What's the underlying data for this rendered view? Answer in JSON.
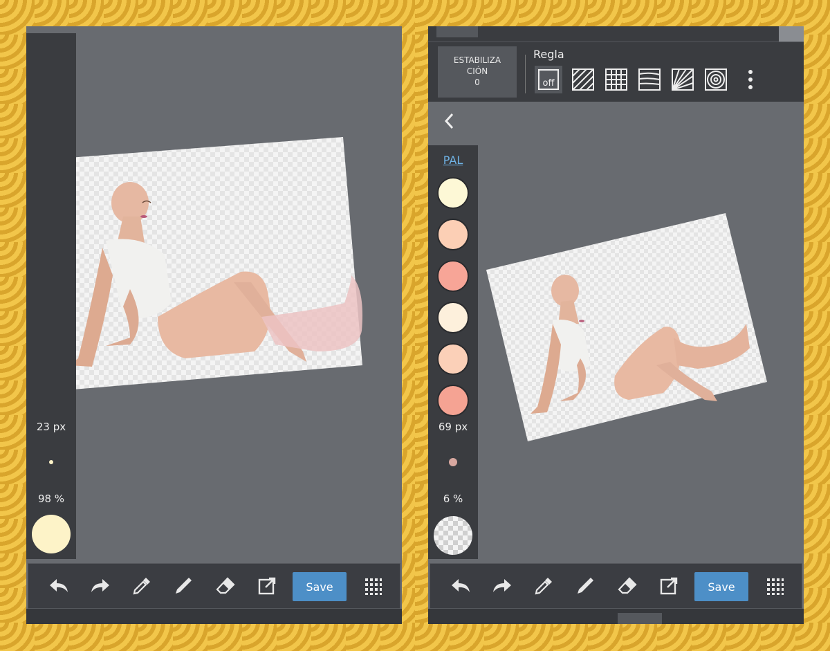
{
  "left": {
    "brush_size": "23 px",
    "opacity": "98 %",
    "color": "#fdf3c8",
    "save_label": "Save"
  },
  "right": {
    "stabilization_label": "ESTABILIZA CIÓN",
    "stabilization_value": "0",
    "ruler_title": "Regla",
    "ruler_off_label": "off",
    "palette_label": "PAL",
    "palette_colors": [
      "#fdf8d6",
      "#fccfb5",
      "#f7a597",
      "#fdf0dc",
      "#fbd0b8",
      "#f5a393"
    ],
    "brush_size": "69 px",
    "opacity": "6 %",
    "save_label": "Save"
  },
  "icons": [
    "undo-icon",
    "redo-icon",
    "eyedropper-icon",
    "pen-icon",
    "eraser-icon",
    "export-icon",
    "grid-menu-icon"
  ]
}
